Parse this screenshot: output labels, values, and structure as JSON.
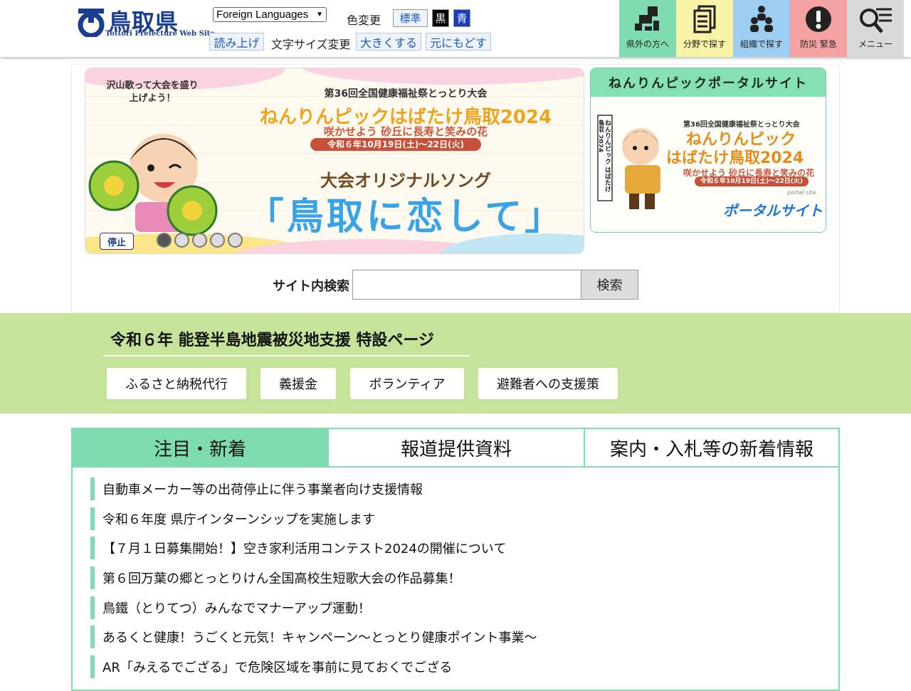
{
  "header": {
    "logo_title": "鳥取県",
    "logo_sub": "Tottori Prefecture Web Site",
    "language_select": "Foreign Languages",
    "color_label": "色変更",
    "color_standard": "標準",
    "color_black": "黒",
    "color_blue": "青",
    "read_aloud": "読み上げ",
    "size_label": "文字サイズ変更",
    "size_up": "大きくする",
    "size_reset": "元にもどす",
    "nav": [
      {
        "label": "県外の方へ",
        "icon": "map-icon",
        "color": "#7fdcb0"
      },
      {
        "label": "分野で探す",
        "icon": "documents-icon",
        "color": "#f8f3a6"
      },
      {
        "label": "組織で探す",
        "icon": "people-icon",
        "color": "#9ecdf2"
      },
      {
        "label": "防災 緊急",
        "icon": "alert-icon",
        "color": "#f5a2a2"
      },
      {
        "label": "メニュー",
        "icon": "search-menu-icon",
        "color": "#d9d9d9"
      }
    ]
  },
  "slider": {
    "bubble": "沢山歌って大会を盛り上げよう！",
    "event": "第36回全国健康福祉祭とっとり大会",
    "main": "ねんりんピックはばたけ鳥取2024",
    "theme": "咲かせよう 砂丘に長寿と笑みの花",
    "date": "令和６年10月19日(土)～22日(火)",
    "song_label": "大会オリジナルソング",
    "song_title": "「鳥取に恋して」",
    "stop_label": "停止",
    "dot_count": 5
  },
  "portal": {
    "heading": "ねんりんピックポータルサイト",
    "banner_flag": "ねんりんピック はばたけ鳥取 2024",
    "event": "第36回全国健康福祉祭とっとり大会",
    "main1": "ねんりんピック",
    "main2": "はばたけ鳥取2024",
    "theme": "咲かせよう 砂丘に長寿と笑みの花",
    "date": "令和６年10月19日(土)～22日(火)",
    "portal_sub": "portal site",
    "portal_text": "ポータルサイト"
  },
  "search": {
    "label": "サイト内検索",
    "button": "検索",
    "value": ""
  },
  "quake": {
    "title": "令和６年 能登半島地震被災地支援 特設ページ",
    "buttons": [
      "ふるさと納税代行",
      "義援金",
      "ボランティア",
      "避難者への支援策"
    ]
  },
  "news": {
    "tabs": [
      "注目・新着",
      "報道提供資料",
      "案内・入札等の新着情報"
    ],
    "items": [
      "自動車メーカー等の出荷停止に伴う事業者向け支援情報",
      "令和６年度 県庁インターンシップを実施します",
      "【７月１日募集開始！】空き家利活用コンテスト2024の開催について",
      "第６回万葉の郷とっとりけん全国高校生短歌大会の作品募集！",
      "鳥鐵（とりてつ）みんなでマナーアップ運動！",
      "あるくと健康！うごくと元気！キャンペーン～とっとり健康ポイント事業～",
      "AR「みえるでござる」で危険区域を事前に見ておくでござる"
    ]
  },
  "colors": {
    "brand": "#1a3d8f",
    "accent_green": "#7fdcb0",
    "quake_band": "#c6e39a"
  }
}
